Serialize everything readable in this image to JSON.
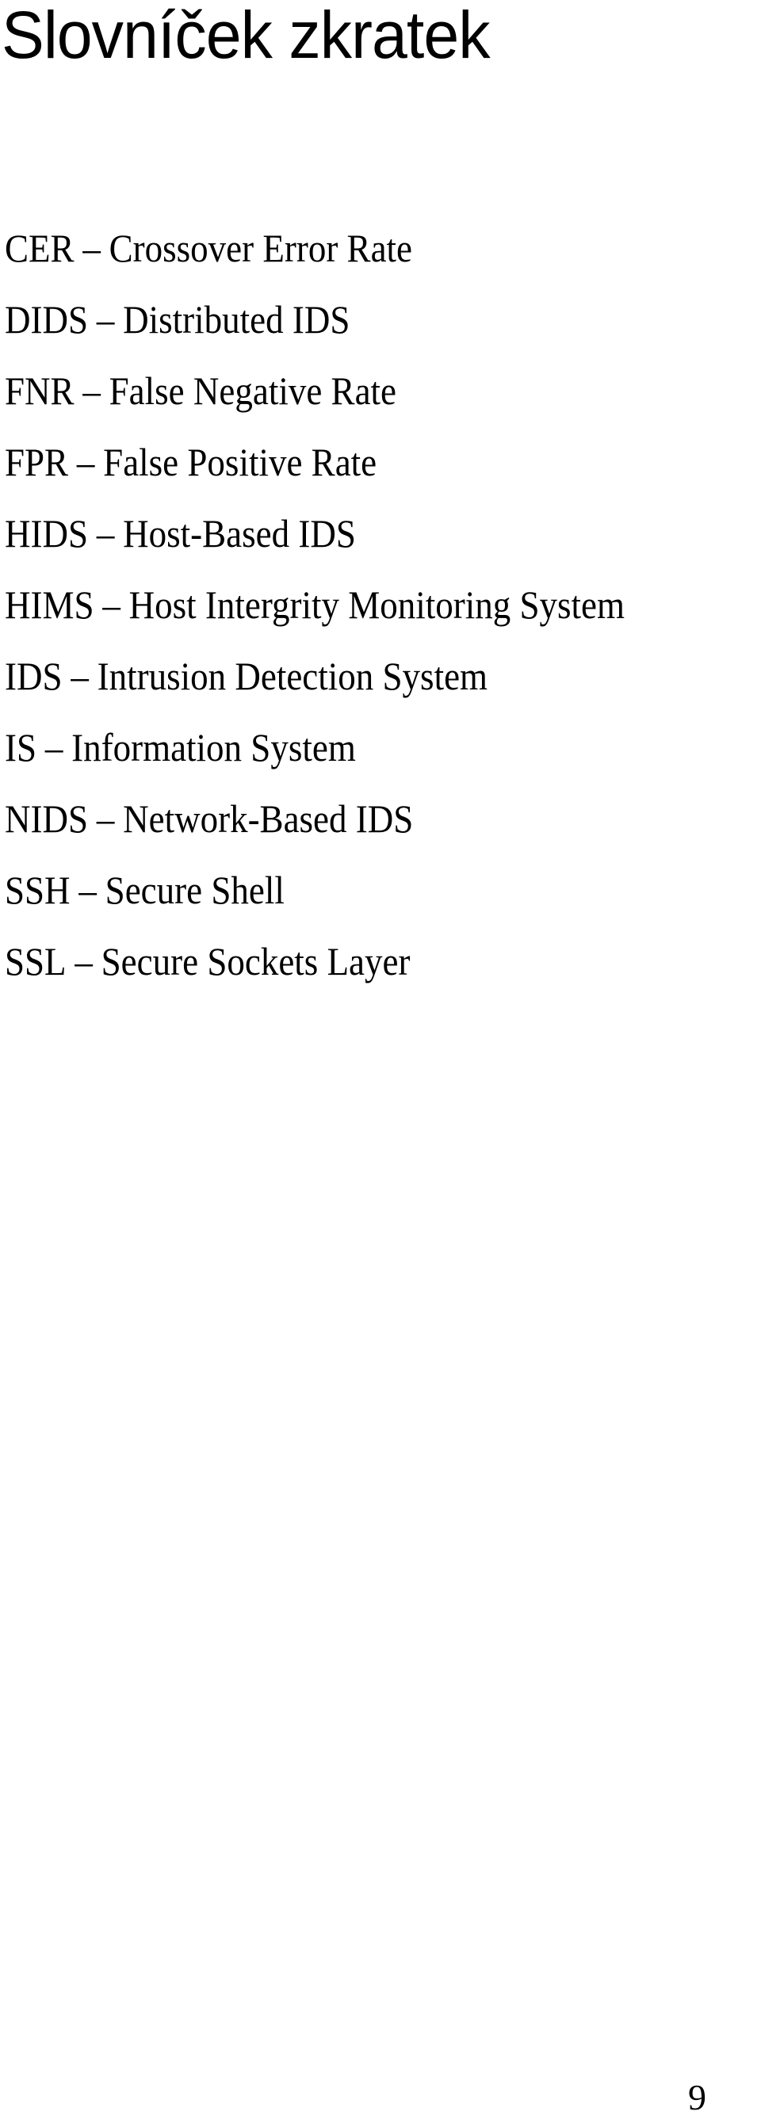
{
  "page": {
    "title": "Slovníček zkratek",
    "page_number": "9"
  },
  "separator": "–",
  "abbreviations": [
    {
      "abbr": "CER",
      "definition": "Crossover Error Rate"
    },
    {
      "abbr": "DIDS",
      "definition": "Distributed IDS"
    },
    {
      "abbr": "FNR",
      "definition": "False Negative Rate"
    },
    {
      "abbr": "FPR",
      "definition": "False Positive Rate"
    },
    {
      "abbr": "HIDS",
      "definition": "Host-Based IDS"
    },
    {
      "abbr": "HIMS",
      "definition": "Host Intergrity Monitoring System"
    },
    {
      "abbr": "IDS",
      "definition": "Intrusion Detection System"
    },
    {
      "abbr": "IS",
      "definition": "Information System"
    },
    {
      "abbr": "NIDS",
      "definition": "Network-Based IDS"
    },
    {
      "abbr": "SSH",
      "definition": "Secure Shell"
    },
    {
      "abbr": "SSL",
      "definition": "Secure Sockets Layer"
    }
  ]
}
